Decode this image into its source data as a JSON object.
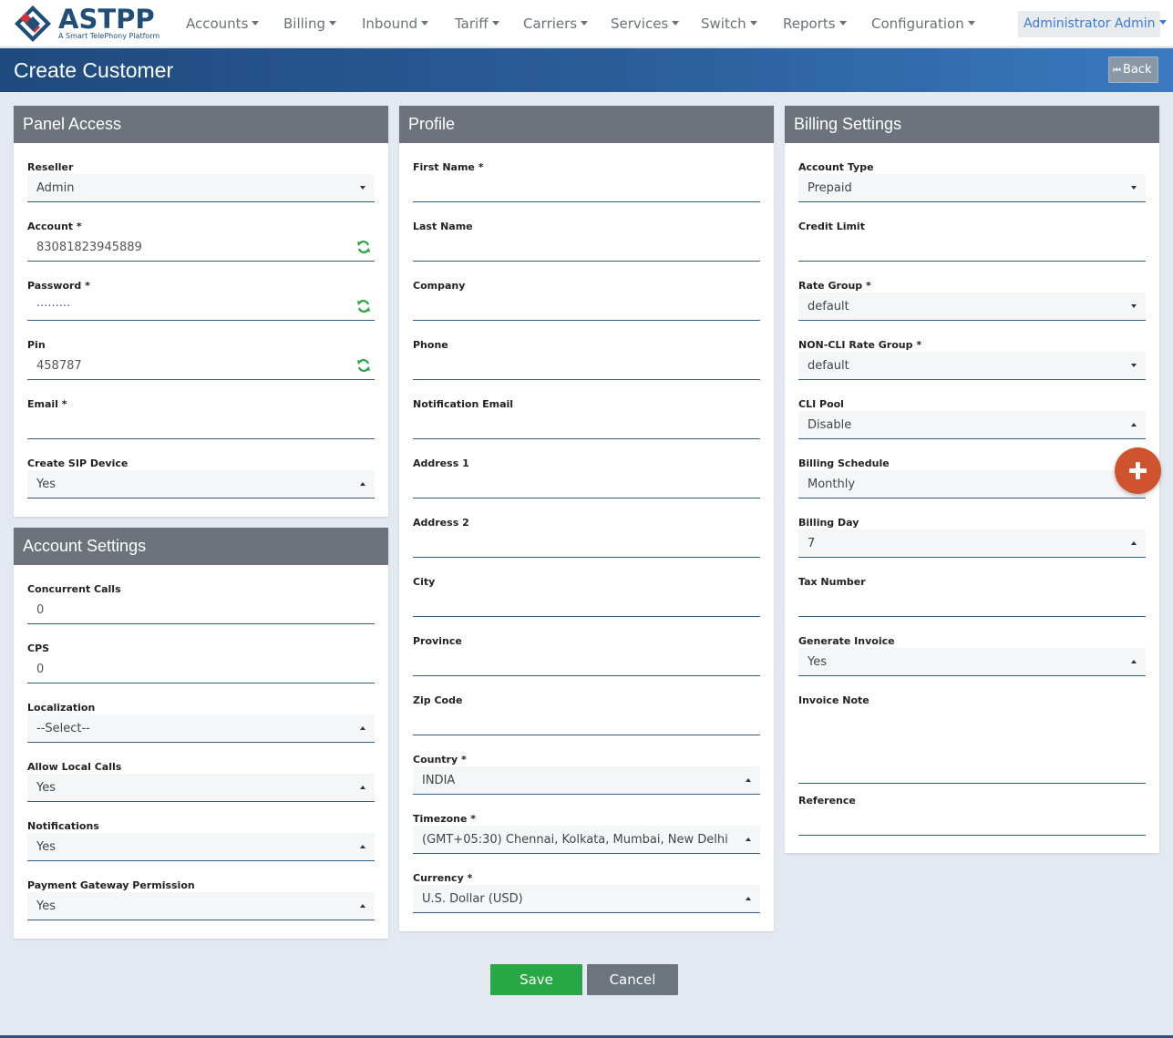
{
  "brand": {
    "name": "ASTPP",
    "tagline": "A Smart TelePhony Platform"
  },
  "nav": [
    {
      "label": "Accounts"
    },
    {
      "label": "Billing"
    },
    {
      "label": "Inbound"
    },
    {
      "label": "Tariff"
    },
    {
      "label": "Carriers"
    },
    {
      "label": "Services"
    },
    {
      "label": "Switch"
    },
    {
      "label": "Reports"
    },
    {
      "label": "Configuration"
    }
  ],
  "user_menu": {
    "label": "Administrator Admin"
  },
  "page": {
    "title": "Create Customer",
    "back_label": "Back"
  },
  "panel_access": {
    "title": "Panel Access",
    "fields": [
      {
        "label": "Reseller",
        "value": "Admin",
        "type": "select"
      },
      {
        "label": "Account *",
        "value": "83081823945889",
        "type": "input-refresh"
      },
      {
        "label": "Password *",
        "value": "·········",
        "type": "input-refresh"
      },
      {
        "label": "Pin",
        "value": "458787",
        "type": "input-refresh"
      },
      {
        "label": "Email *",
        "value": "",
        "type": "input"
      },
      {
        "label": "Create SIP Device",
        "value": "Yes",
        "type": "select-up"
      }
    ]
  },
  "account_settings": {
    "title": "Account Settings",
    "fields": [
      {
        "label": "Concurrent Calls",
        "value": "0",
        "type": "input"
      },
      {
        "label": "CPS",
        "value": "0",
        "type": "input"
      },
      {
        "label": "Localization",
        "value": "--Select--",
        "type": "select-up"
      },
      {
        "label": "Allow Local Calls",
        "value": "Yes",
        "type": "select-up"
      },
      {
        "label": "Notifications",
        "value": "Yes",
        "type": "select-up"
      },
      {
        "label": "Payment Gateway Permission",
        "value": "Yes",
        "type": "select-up"
      }
    ]
  },
  "profile": {
    "title": "Profile",
    "fields": [
      {
        "label": "First Name *",
        "value": "",
        "type": "input"
      },
      {
        "label": "Last Name",
        "value": "",
        "type": "input"
      },
      {
        "label": "Company",
        "value": "",
        "type": "input"
      },
      {
        "label": "Phone",
        "value": "",
        "type": "input"
      },
      {
        "label": "Notification Email",
        "value": "",
        "type": "input"
      },
      {
        "label": "Address 1",
        "value": "",
        "type": "input"
      },
      {
        "label": "Address 2",
        "value": "",
        "type": "input"
      },
      {
        "label": "City",
        "value": "",
        "type": "input"
      },
      {
        "label": "Province",
        "value": "",
        "type": "input"
      },
      {
        "label": "Zip Code",
        "value": "",
        "type": "input"
      },
      {
        "label": "Country *",
        "value": "INDIA",
        "type": "select-up"
      },
      {
        "label": "Timezone *",
        "value": "(GMT+05:30) Chennai, Kolkata, Mumbai, New Delhi",
        "type": "select-up"
      },
      {
        "label": "Currency *",
        "value": "U.S. Dollar (USD)",
        "type": "select-up"
      }
    ]
  },
  "billing_settings": {
    "title": "Billing Settings",
    "fields": [
      {
        "label": "Account Type",
        "value": "Prepaid",
        "type": "select"
      },
      {
        "label": "Credit Limit",
        "value": "",
        "type": "input"
      },
      {
        "label": "Rate Group *",
        "value": "default",
        "type": "select"
      },
      {
        "label": "NON-CLI Rate Group *",
        "value": "default",
        "type": "select"
      },
      {
        "label": "CLI Pool",
        "value": "Disable",
        "type": "select-up"
      },
      {
        "label": "Billing Schedule",
        "value": "Monthly",
        "type": "select-up"
      },
      {
        "label": "Billing Day",
        "value": "7",
        "type": "select-up"
      },
      {
        "label": "Tax Number",
        "value": "",
        "type": "input"
      },
      {
        "label": "Generate Invoice",
        "value": "Yes",
        "type": "select-up"
      },
      {
        "label": "Invoice Note",
        "value": "",
        "type": "textarea"
      },
      {
        "label": "Reference",
        "value": "",
        "type": "input"
      }
    ]
  },
  "actions": {
    "save": "Save",
    "cancel": "Cancel"
  },
  "colors": {
    "header": "#1e4a7d",
    "save": "#28a745",
    "cancel": "#6c757d",
    "fab": "#d0532f",
    "refresh": "#28a745"
  }
}
